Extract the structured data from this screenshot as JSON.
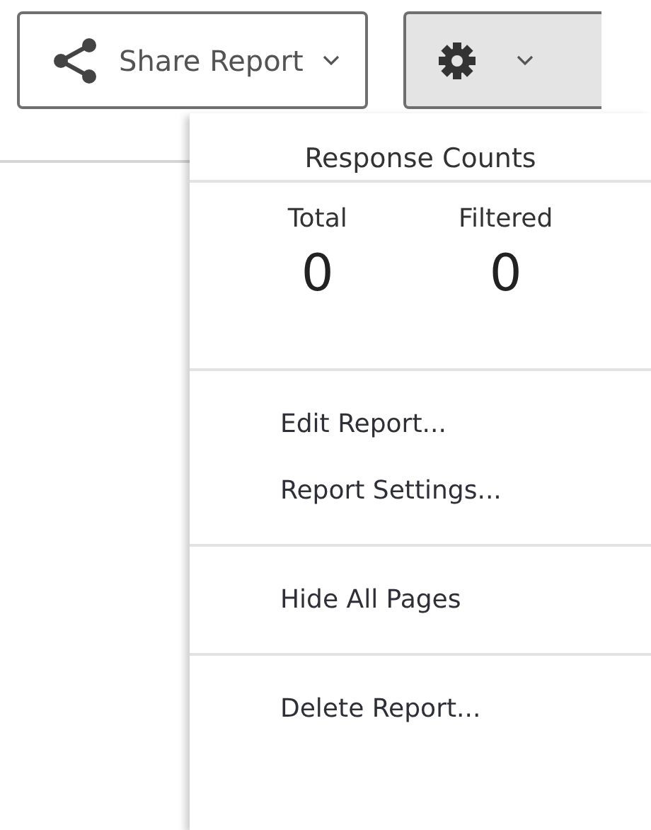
{
  "toolbar": {
    "share_button": {
      "label": "Share Report"
    },
    "settings_button": {
      "expanded": true
    }
  },
  "menu": {
    "title": "Response Counts",
    "counts": [
      {
        "label": "Total",
        "value": "0"
      },
      {
        "label": "Filtered",
        "value": "0"
      }
    ],
    "groups": [
      [
        "Edit Report...",
        "Report Settings..."
      ],
      [
        "Hide All Pages"
      ],
      [
        "Delete Report..."
      ]
    ]
  }
}
